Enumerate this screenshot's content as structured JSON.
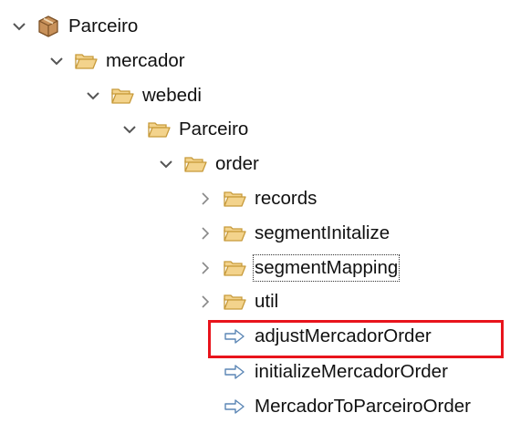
{
  "tree": {
    "nodes": [
      {
        "label": "Parceiro",
        "kind": "project",
        "expand": "expanded"
      },
      {
        "label": "mercador",
        "kind": "folder",
        "expand": "expanded"
      },
      {
        "label": "webedi",
        "kind": "folder",
        "expand": "expanded"
      },
      {
        "label": "Parceiro",
        "kind": "folder",
        "expand": "expanded"
      },
      {
        "label": "order",
        "kind": "folder",
        "expand": "expanded"
      },
      {
        "label": "records",
        "kind": "folder",
        "expand": "collapsed"
      },
      {
        "label": "segmentInitalize",
        "kind": "folder",
        "expand": "collapsed"
      },
      {
        "label": "segmentMapping",
        "kind": "folder",
        "expand": "collapsed",
        "focused": true
      },
      {
        "label": "util",
        "kind": "folder",
        "expand": "collapsed"
      },
      {
        "label": "adjustMercadorOrder",
        "kind": "flow",
        "expand": "none",
        "highlighted": true
      },
      {
        "label": "initializeMercadorOrder",
        "kind": "flow",
        "expand": "none"
      },
      {
        "label": "MercadorToParceiroOrder",
        "kind": "flow",
        "expand": "none"
      }
    ]
  },
  "colors": {
    "highlight_border": "#e8141c",
    "folder_fill": "#f3d38c",
    "folder_stroke": "#c79a3a",
    "project_fill": "#c8915a",
    "flow_stroke": "#5b86b5"
  },
  "icons": {
    "project": "package-box-icon",
    "folder": "open-folder-icon",
    "flow": "flow-arrow-icon",
    "expanded": "chevron-down-icon",
    "collapsed": "chevron-right-icon"
  }
}
